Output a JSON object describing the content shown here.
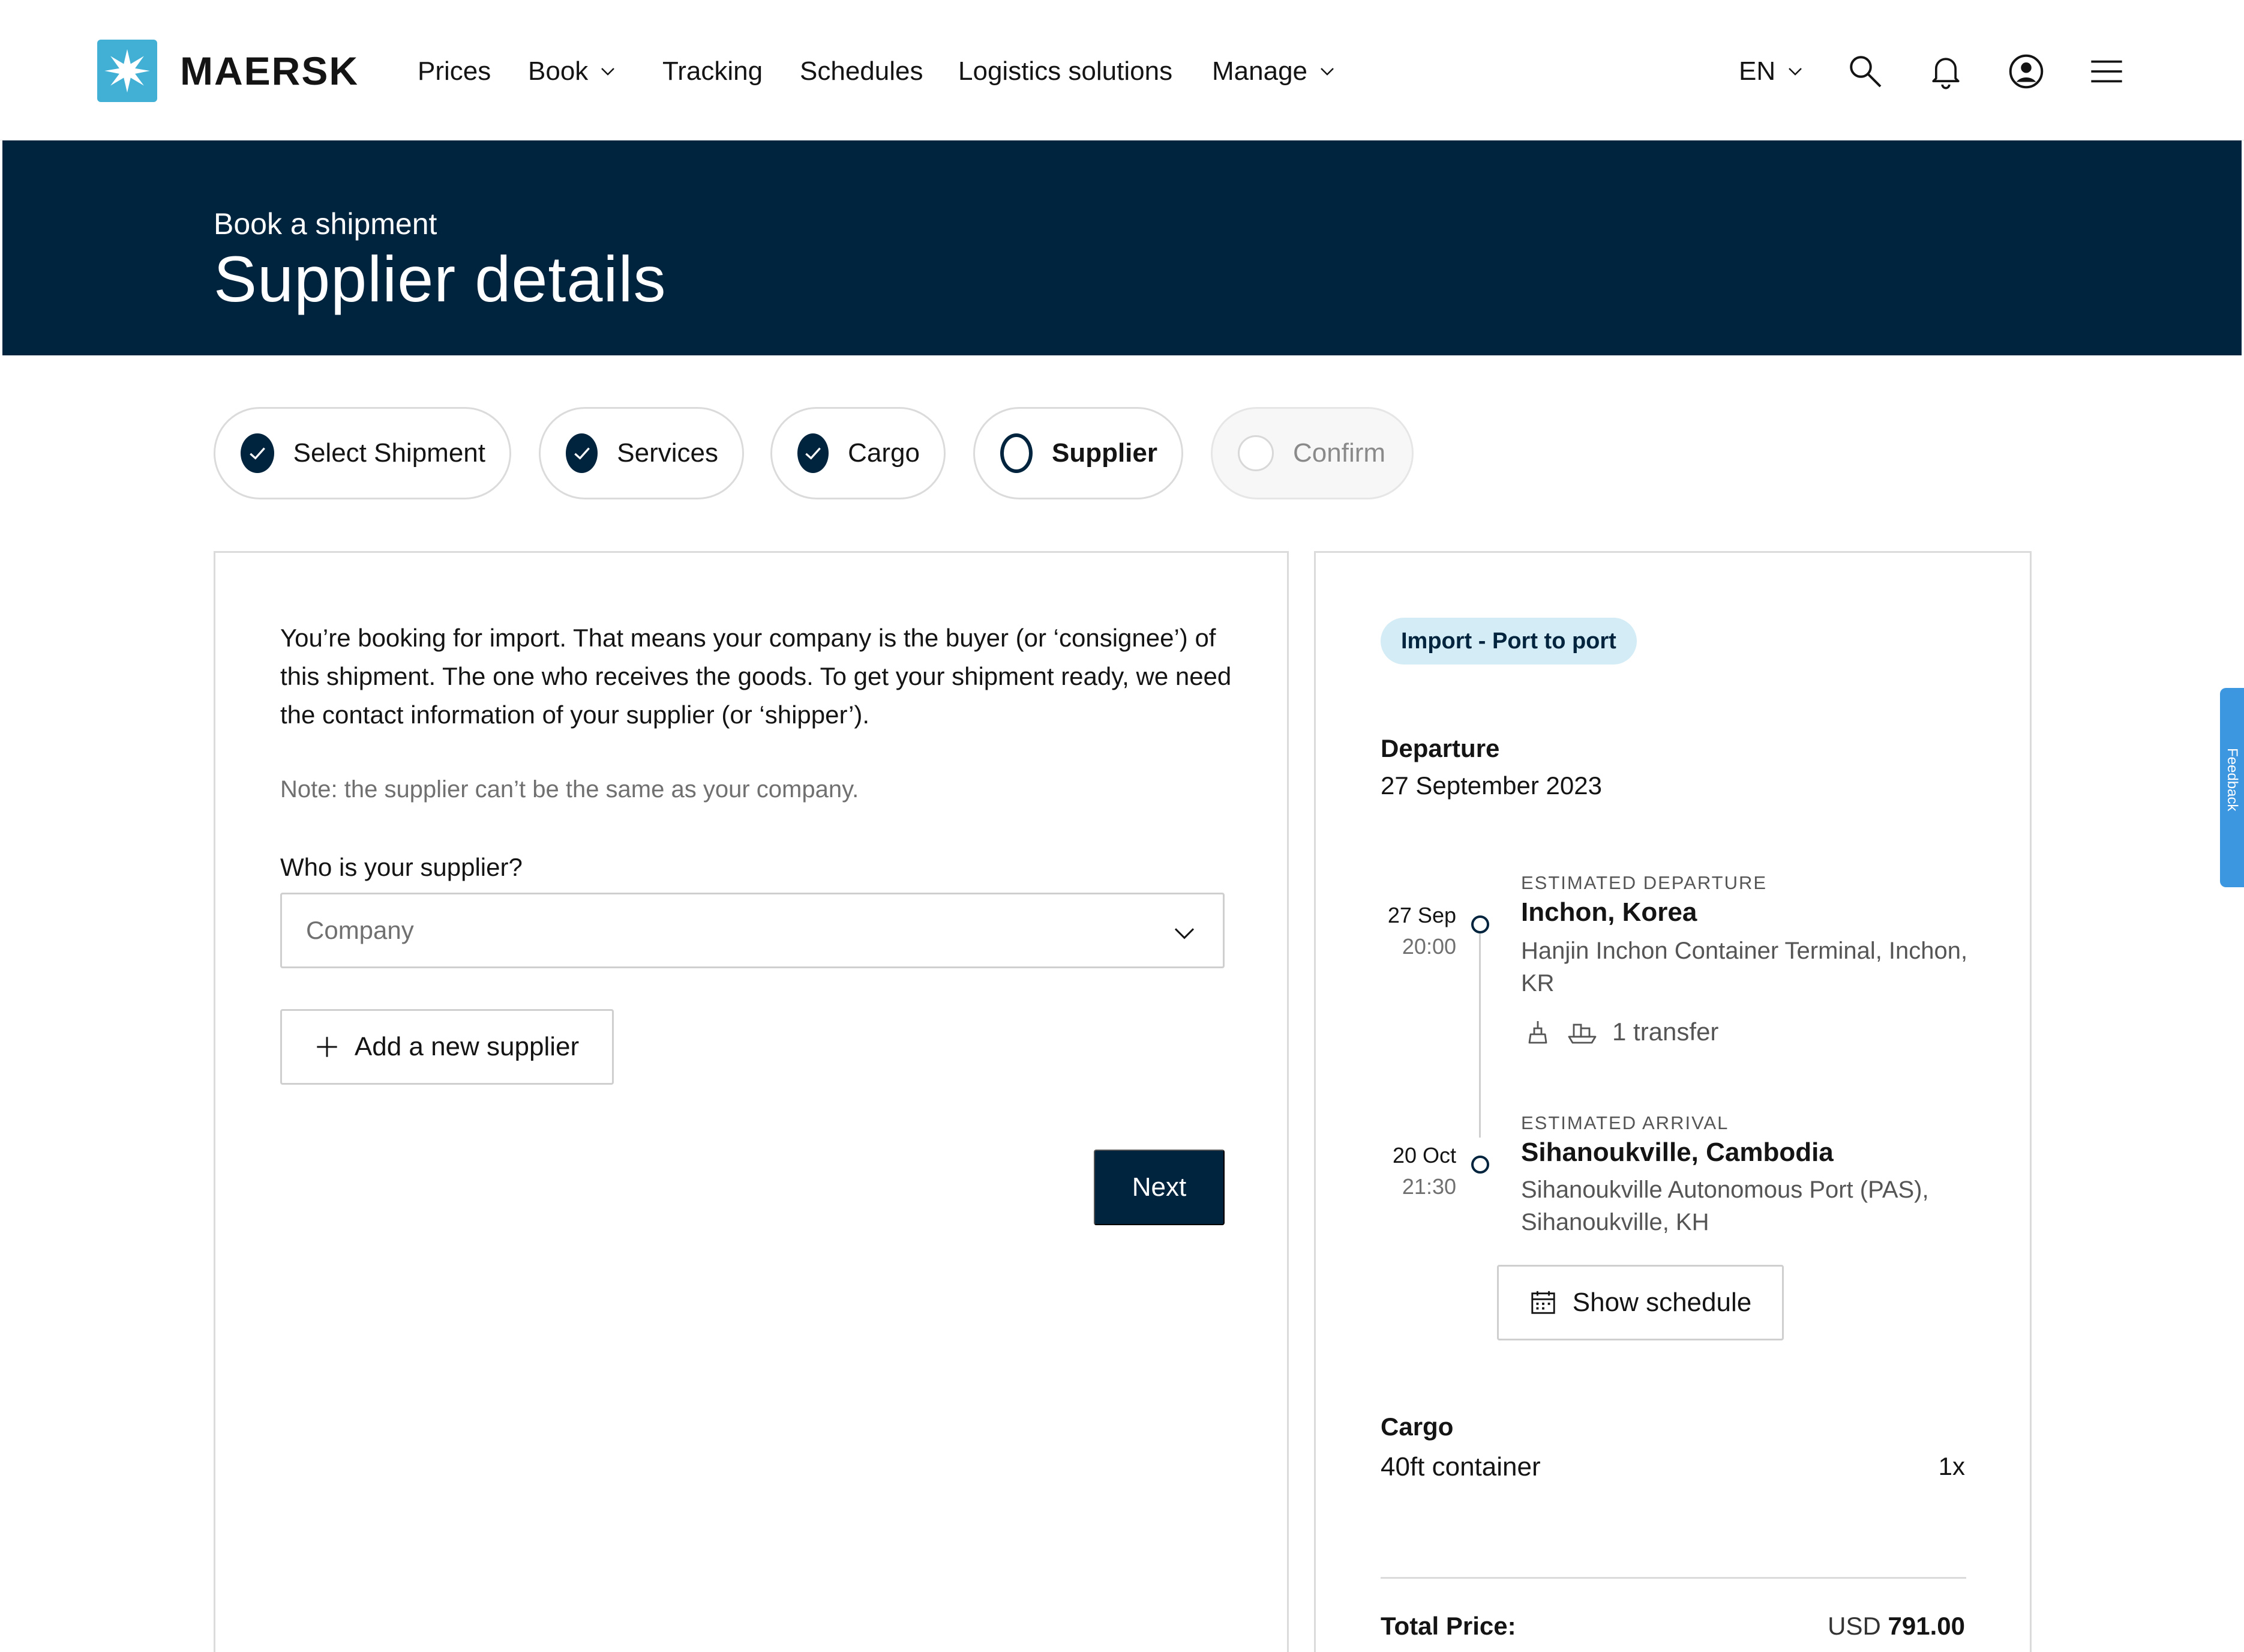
{
  "brand": {
    "name": "MAERSK",
    "logo_color": "#42b0d5"
  },
  "nav": {
    "items": [
      {
        "label": "Prices",
        "dropdown": false
      },
      {
        "label": "Book",
        "dropdown": true
      },
      {
        "label": "Tracking",
        "dropdown": false
      },
      {
        "label": "Schedules",
        "dropdown": false
      },
      {
        "label": "Logistics solutions",
        "dropdown": false
      },
      {
        "label": "Manage",
        "dropdown": true
      }
    ],
    "language": "EN",
    "icons": [
      "search-icon",
      "bell-icon",
      "user-icon",
      "menu-icon"
    ]
  },
  "banner": {
    "subtitle": "Book a shipment",
    "title": "Supplier details",
    "bg_color": "#00243d"
  },
  "stepper": {
    "steps": [
      {
        "label": "Select Shipment",
        "state": "done"
      },
      {
        "label": "Services",
        "state": "done"
      },
      {
        "label": "Cargo",
        "state": "done"
      },
      {
        "label": "Supplier",
        "state": "current"
      },
      {
        "label": "Confirm",
        "state": "disabled"
      }
    ]
  },
  "form": {
    "intro": "You’re booking for import. That means your company is the buyer (or ‘consignee’) of this shipment. The one who receives the goods. To get your shipment ready, we need the contact information of your supplier (or ‘shipper’).",
    "note": "Note: the supplier can’t be the same as your company.",
    "question": "Who is your supplier?",
    "select_placeholder": "Company",
    "add_supplier_label": "Add a new supplier",
    "next_label": "Next"
  },
  "summary": {
    "tag": "Import - Port to port",
    "departure_heading": "Departure",
    "departure_date": "27 September 2023",
    "origin": {
      "date": "27 Sep",
      "time": "20:00",
      "caption": "ESTIMATED DEPARTURE",
      "city": "Inchon, Korea",
      "address": "Hanjin Inchon Container Terminal, Inchon, KR"
    },
    "transfer": "1 transfer",
    "destination": {
      "date": "20 Oct",
      "time": "21:30",
      "caption": "ESTIMATED ARRIVAL",
      "city": "Sihanoukville, Cambodia",
      "address": "Sihanoukville Autonomous Port (PAS), Sihanoukville, KH"
    },
    "show_schedule_label": "Show schedule",
    "cargo_heading": "Cargo",
    "cargo_item": "40ft container",
    "cargo_qty": "1x",
    "total_label": "Total Price:",
    "total_currency": "USD",
    "total_amount": "791.00"
  },
  "feedback": {
    "label": "Feedback",
    "color": "#3c96e0"
  }
}
